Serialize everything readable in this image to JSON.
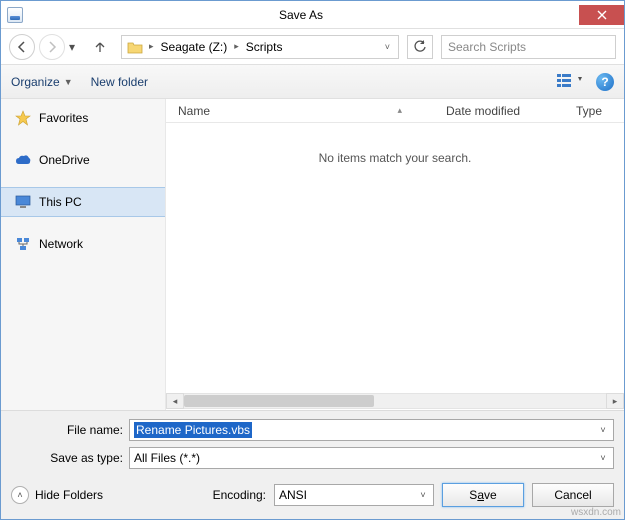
{
  "title": "Save As",
  "breadcrumb": {
    "drive": "Seagate (Z:)",
    "folder": "Scripts"
  },
  "search": {
    "placeholder": "Search Scripts"
  },
  "toolbar": {
    "organize": "Organize",
    "newfolder": "New folder"
  },
  "columns": {
    "name": "Name",
    "modified": "Date modified",
    "type": "Type"
  },
  "empty_msg": "No items match your search.",
  "sidebar": {
    "favorites": "Favorites",
    "onedrive": "OneDrive",
    "thispc": "This PC",
    "network": "Network"
  },
  "labels": {
    "filename": "File name:",
    "saveastype": "Save as type:",
    "encoding": "Encoding:",
    "hide": "Hide Folders"
  },
  "values": {
    "filename": "Rename Pictures.vbs",
    "saveastype": "All Files  (*.*)",
    "encoding": "ANSI"
  },
  "buttons": {
    "save_pre": "S",
    "save_u": "a",
    "save_post": "ve",
    "cancel": "Cancel"
  },
  "watermark": "wsxdn.com"
}
